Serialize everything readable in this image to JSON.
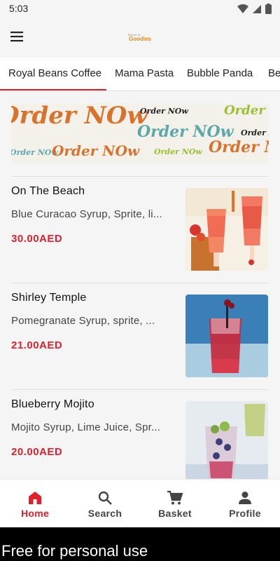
{
  "status_bar": {
    "time": "5:03"
  },
  "app": {
    "logo_small": "Beans of",
    "logo_main": "Goodies",
    "brand_color": "#e0202b"
  },
  "tabs": [
    {
      "label": "Royal Beans Coffee",
      "active": true
    },
    {
      "label": "Mama Pasta",
      "active": false
    },
    {
      "label": "Bubble Panda",
      "active": false
    },
    {
      "label": "Be",
      "active": false
    }
  ],
  "banner": {
    "text": "Order NOw",
    "small_text": "Order NOw"
  },
  "products": [
    {
      "name": "On The Beach",
      "description": "Blue Curacao Syrup, Sprite, li...",
      "price": "30.00AED",
      "image_icon": "cocktail-image"
    },
    {
      "name": "Shirley Temple",
      "description": "Pomegranate Syrup, sprite, ...",
      "price": "21.00AED",
      "image_icon": "cocktail-image"
    },
    {
      "name": "Blueberry Mojito",
      "description": "Mojito Syrup, Lime Juice, Spr...",
      "price": "20.00AED",
      "image_icon": "cocktail-image"
    }
  ],
  "bottom_nav": [
    {
      "label": "Home",
      "icon": "home-icon",
      "active": true
    },
    {
      "label": "Search",
      "icon": "search-icon",
      "active": false
    },
    {
      "label": "Basket",
      "icon": "basket-icon",
      "active": false
    },
    {
      "label": "Profile",
      "icon": "profile-icon",
      "active": false
    }
  ],
  "footer": {
    "text": "Free for personal use"
  }
}
